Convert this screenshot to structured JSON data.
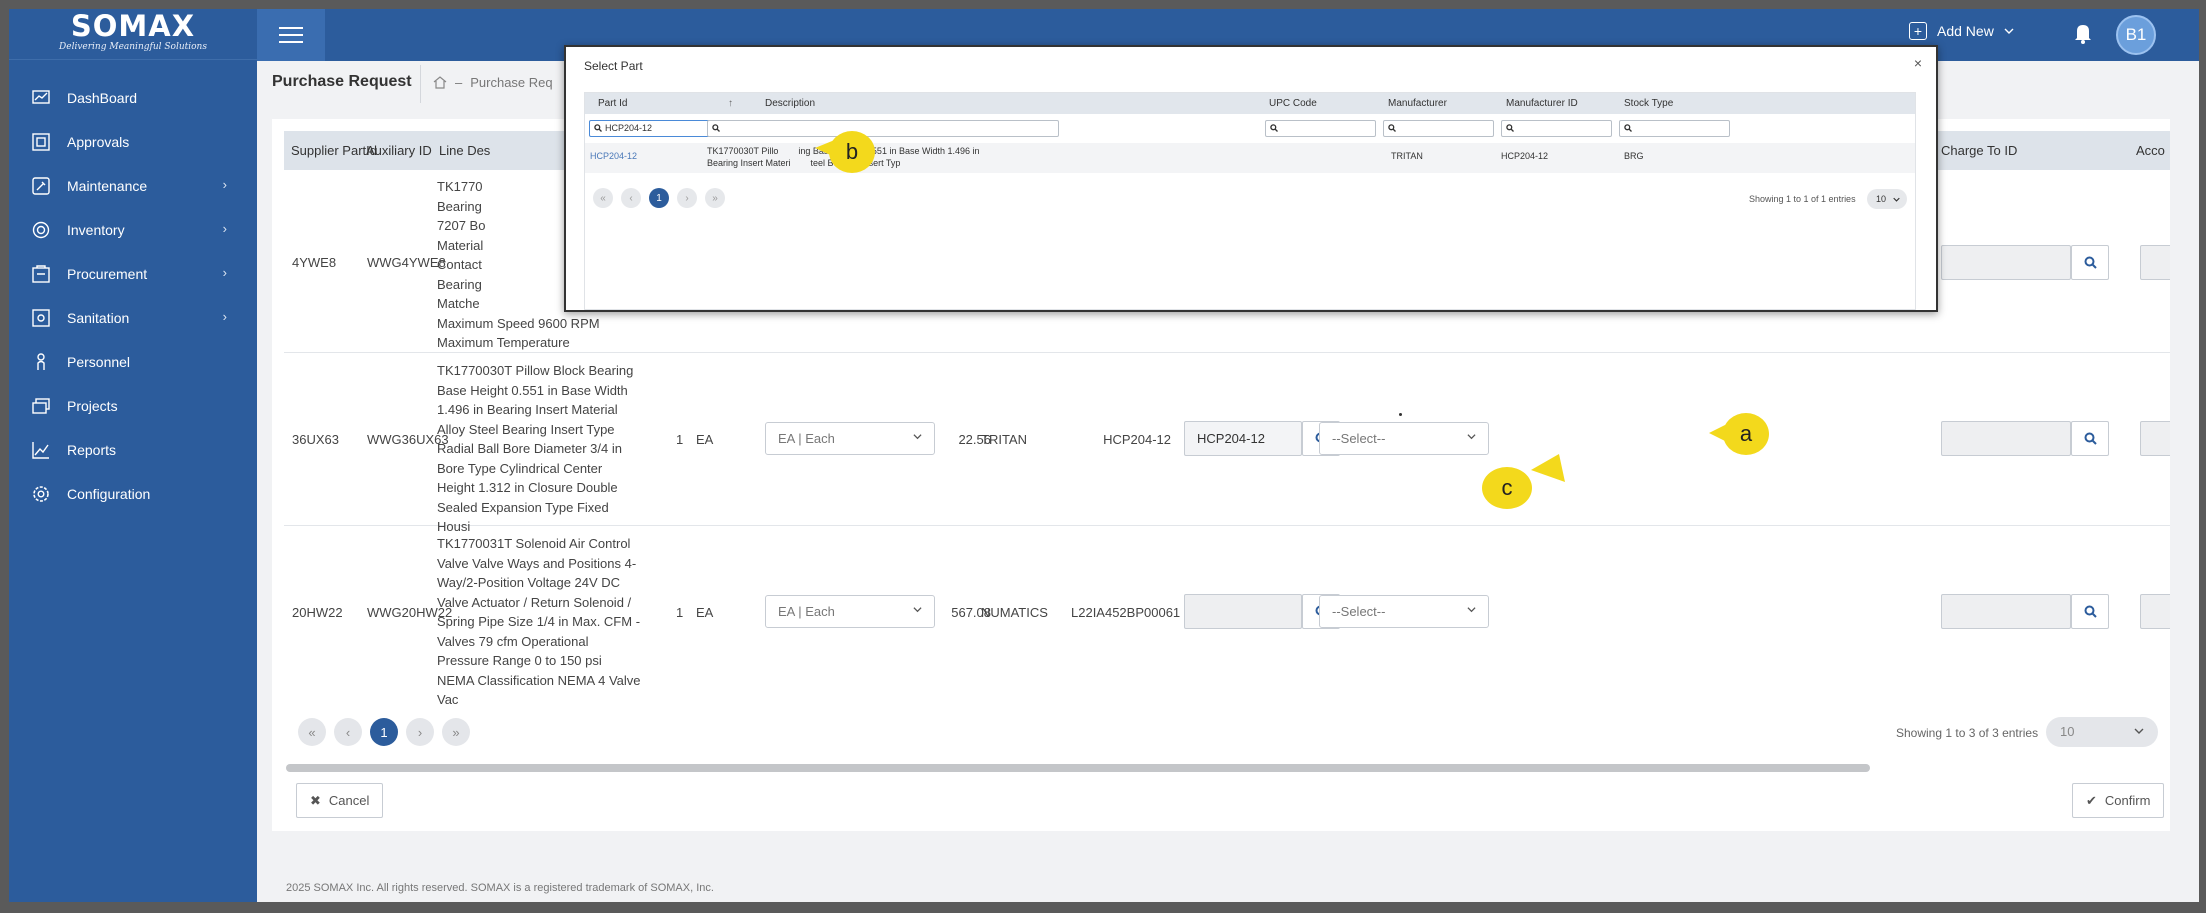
{
  "app": {
    "brand": "SOMAX",
    "tagline": "Delivering Meaningful Solutions"
  },
  "sidebar": {
    "items": [
      {
        "label": "DashBoard",
        "icon": "dashboard-icon",
        "has_children": false
      },
      {
        "label": "Approvals",
        "icon": "approvals-icon",
        "has_children": false
      },
      {
        "label": "Maintenance",
        "icon": "maintenance-icon",
        "has_children": true
      },
      {
        "label": "Inventory",
        "icon": "inventory-icon",
        "has_children": true
      },
      {
        "label": "Procurement",
        "icon": "procurement-icon",
        "has_children": true
      },
      {
        "label": "Sanitation",
        "icon": "sanitation-icon",
        "has_children": true
      },
      {
        "label": "Personnel",
        "icon": "personnel-icon",
        "has_children": false
      },
      {
        "label": "Projects",
        "icon": "projects-icon",
        "has_children": false
      },
      {
        "label": "Reports",
        "icon": "reports-icon",
        "has_children": false
      },
      {
        "label": "Configuration",
        "icon": "configuration-icon",
        "has_children": false
      }
    ]
  },
  "header": {
    "add_new": "Add New",
    "avatar": "B1"
  },
  "page": {
    "title": "Purchase Request",
    "breadcrumb_sep": "–",
    "breadcrumb": "Purchase Req"
  },
  "table": {
    "columns": [
      "Supplier PartId",
      "Auxiliary ID",
      "Line Des",
      "Charge To ID",
      "Acco"
    ],
    "rows": [
      {
        "supplier_part": "4YWE8",
        "aux_id": "WWG4YWE8",
        "desc": "TK1770\nBearing \n7207 Bo\nMaterial\nContact\nBearing \nMatche\nMaximum Speed 9600 RPM\nMaximum Temperature",
        "qty": "",
        "uom": "",
        "uom_select": "",
        "unit_cost": "",
        "manufacturer": "",
        "mfr_id": "",
        "part_value": "",
        "select": "",
        "charge_to": ""
      },
      {
        "supplier_part": "36UX63",
        "aux_id": "WWG36UX63",
        "desc": "TK1770030T Pillow Block Bearing Base Height 0.551 in Base Width 1.496 in Bearing Insert Material Alloy Steel Bearing Insert Type Radial Ball Bore Diameter 3/4 in Bore Type Cylindrical Center Height 1.312 in Closure Double Sealed Expansion Type Fixed Housi",
        "qty": "1",
        "uom": "EA",
        "uom_select": "EA | Each",
        "unit_cost": "22.56",
        "manufacturer": "TRITAN",
        "mfr_id": "HCP204-12",
        "part_value": "HCP204-12",
        "select": "--Select--",
        "charge_to": ""
      },
      {
        "supplier_part": "20HW22",
        "aux_id": "WWG20HW22",
        "desc": "TK1770031T Solenoid Air Control Valve Valve Ways and Positions 4-Way/2-Position Voltage 24V DC Valve Actuator / Return Solenoid / Spring Pipe Size 1/4 in Max. CFM - Valves 79 cfm Operational Pressure Range 0 to 150 psi NEMA Classification NEMA 4 Valve Vac",
        "qty": "1",
        "uom": "EA",
        "uom_select": "EA | Each",
        "unit_cost": "567.08",
        "manufacturer": "NUMATICS",
        "mfr_id": "L22IA452BP00061",
        "part_value": "",
        "select": "--Select--",
        "charge_to": ""
      }
    ],
    "pager": {
      "first": "«",
      "prev": "‹",
      "current": "1",
      "next": "›",
      "last": "»"
    },
    "showing": "Showing 1 to 3 of 3 entries",
    "page_size": "10"
  },
  "actions": {
    "cancel": "Cancel",
    "confirm": "Confirm"
  },
  "footer": "2025 SOMAX Inc. All rights reserved. SOMAX is a registered trademark of SOMAX, Inc.",
  "modal": {
    "title": "Select Part",
    "close": "×",
    "columns": [
      "Part Id",
      "Description",
      "UPC Code",
      "Manufacturer",
      "Manufacturer ID",
      "Stock Type"
    ],
    "sort_indicator": "↑",
    "filter_part_id": "HCP204-12",
    "row": {
      "part_id": "HCP204-12",
      "description_line1": "TK1770030T Pillo        ing Base Height 0.551 in Base Width 1.496 in",
      "description_line2": "Bearing Insert Materi        teel Bearing Insert Typ",
      "upc": "",
      "manufacturer": "TRITAN",
      "mfr_id": "HCP204-12",
      "stock_type": "BRG"
    },
    "pager": {
      "first": "«",
      "prev": "‹",
      "current": "1",
      "next": "›",
      "last": "»"
    },
    "showing": "Showing 1 to 1 of 1 entries",
    "page_size": "10"
  },
  "callouts": {
    "a": "a",
    "b": "b",
    "c": "c"
  },
  "colors": {
    "brand": "#2c5c9c",
    "callout": "#f3d91c",
    "accent_link": "#4a78b8"
  }
}
